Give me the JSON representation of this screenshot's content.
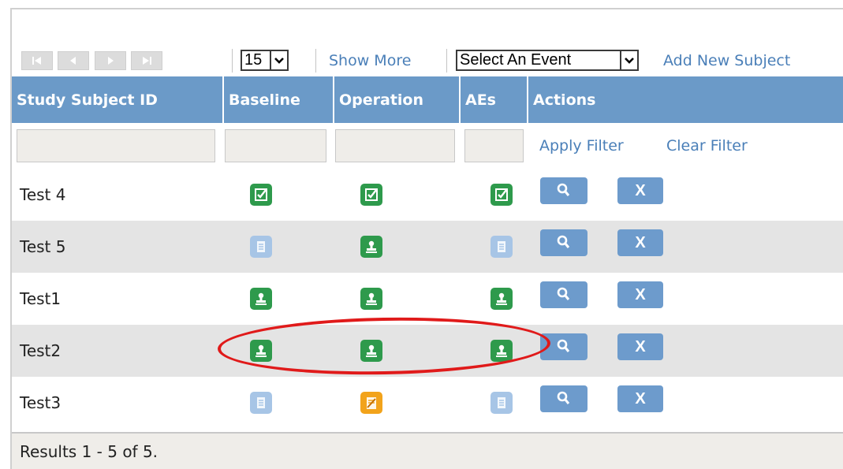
{
  "toolbar": {
    "page_size": "15",
    "show_more": "Show More",
    "event_select": "Select An Event",
    "add_subject": "Add New Subject"
  },
  "table": {
    "columns": [
      "Study Subject ID",
      "Baseline",
      "Operation",
      "AEs",
      "Actions"
    ],
    "filter_apply": "Apply Filter",
    "filter_clear": "Clear Filter",
    "rows": [
      {
        "id": "Test 4",
        "baseline": "completed",
        "operation": "completed",
        "aes": "completed"
      },
      {
        "id": "Test 5",
        "baseline": "not-scheduled",
        "operation": "data-entry-started",
        "aes": "not-scheduled"
      },
      {
        "id": "Test1",
        "baseline": "data-entry-started",
        "operation": "data-entry-started",
        "aes": "data-entry-started"
      },
      {
        "id": "Test2",
        "baseline": "data-entry-started",
        "operation": "data-entry-started",
        "aes": "data-entry-started"
      },
      {
        "id": "Test3",
        "baseline": "not-scheduled",
        "operation": "signed",
        "aes": "not-scheduled"
      }
    ],
    "view_label": "",
    "remove_label": "X"
  },
  "footer": {
    "results": "Results 1 - 5 of 5."
  },
  "colors": {
    "header": "#6b9ac8",
    "link": "#4a7fb8",
    "status_green": "#2e9a4c",
    "status_blue": "#a7c5e6",
    "status_orange": "#f2a31b",
    "highlight": "#e01a1a"
  }
}
